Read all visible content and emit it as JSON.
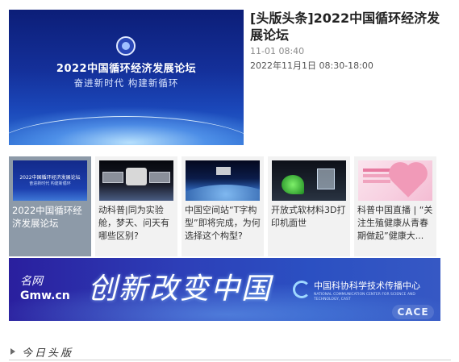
{
  "featured": {
    "image": {
      "banner_title": "2022中国循环经济发展论坛",
      "banner_slogan": "奋进新时代  构建新循环"
    },
    "title": "[头版头条]2022中国循环经济发展论坛",
    "date": "11-01 08:40",
    "time": "2022年11月1日 08:30-18:00"
  },
  "thumbnails": [
    {
      "label": "2022中国循环经济发展论坛",
      "image_caption_title": "2022中国循环经济发展论坛",
      "image_caption_slogan": "奋进新时代 构建新循环",
      "active": true
    },
    {
      "label": "动科普|同为实验舱，梦天、问天有哪些区别?",
      "active": false
    },
    {
      "label": "中国空间站“T字构型”即将完成，为何选择这个构型?",
      "active": false
    },
    {
      "label": "开放式软材料3D打印机面世",
      "active": false
    },
    {
      "label": "科普中国直播 | “关注生殖健康从青春期做起”健康大...",
      "active": false
    }
  ],
  "ad_banner": {
    "logo_top": "名网",
    "logo_bottom": "Gmw.cn",
    "slogan": "创新改变中国",
    "org_name_cn": "中国科协科学技术传播中心",
    "org_name_en": "NATIONAL COMMUNICATION CENTER FOR SCIENCE AND TECHNOLOGY, CAST",
    "badge": "CACE"
  },
  "section": {
    "title": "今日头版"
  }
}
